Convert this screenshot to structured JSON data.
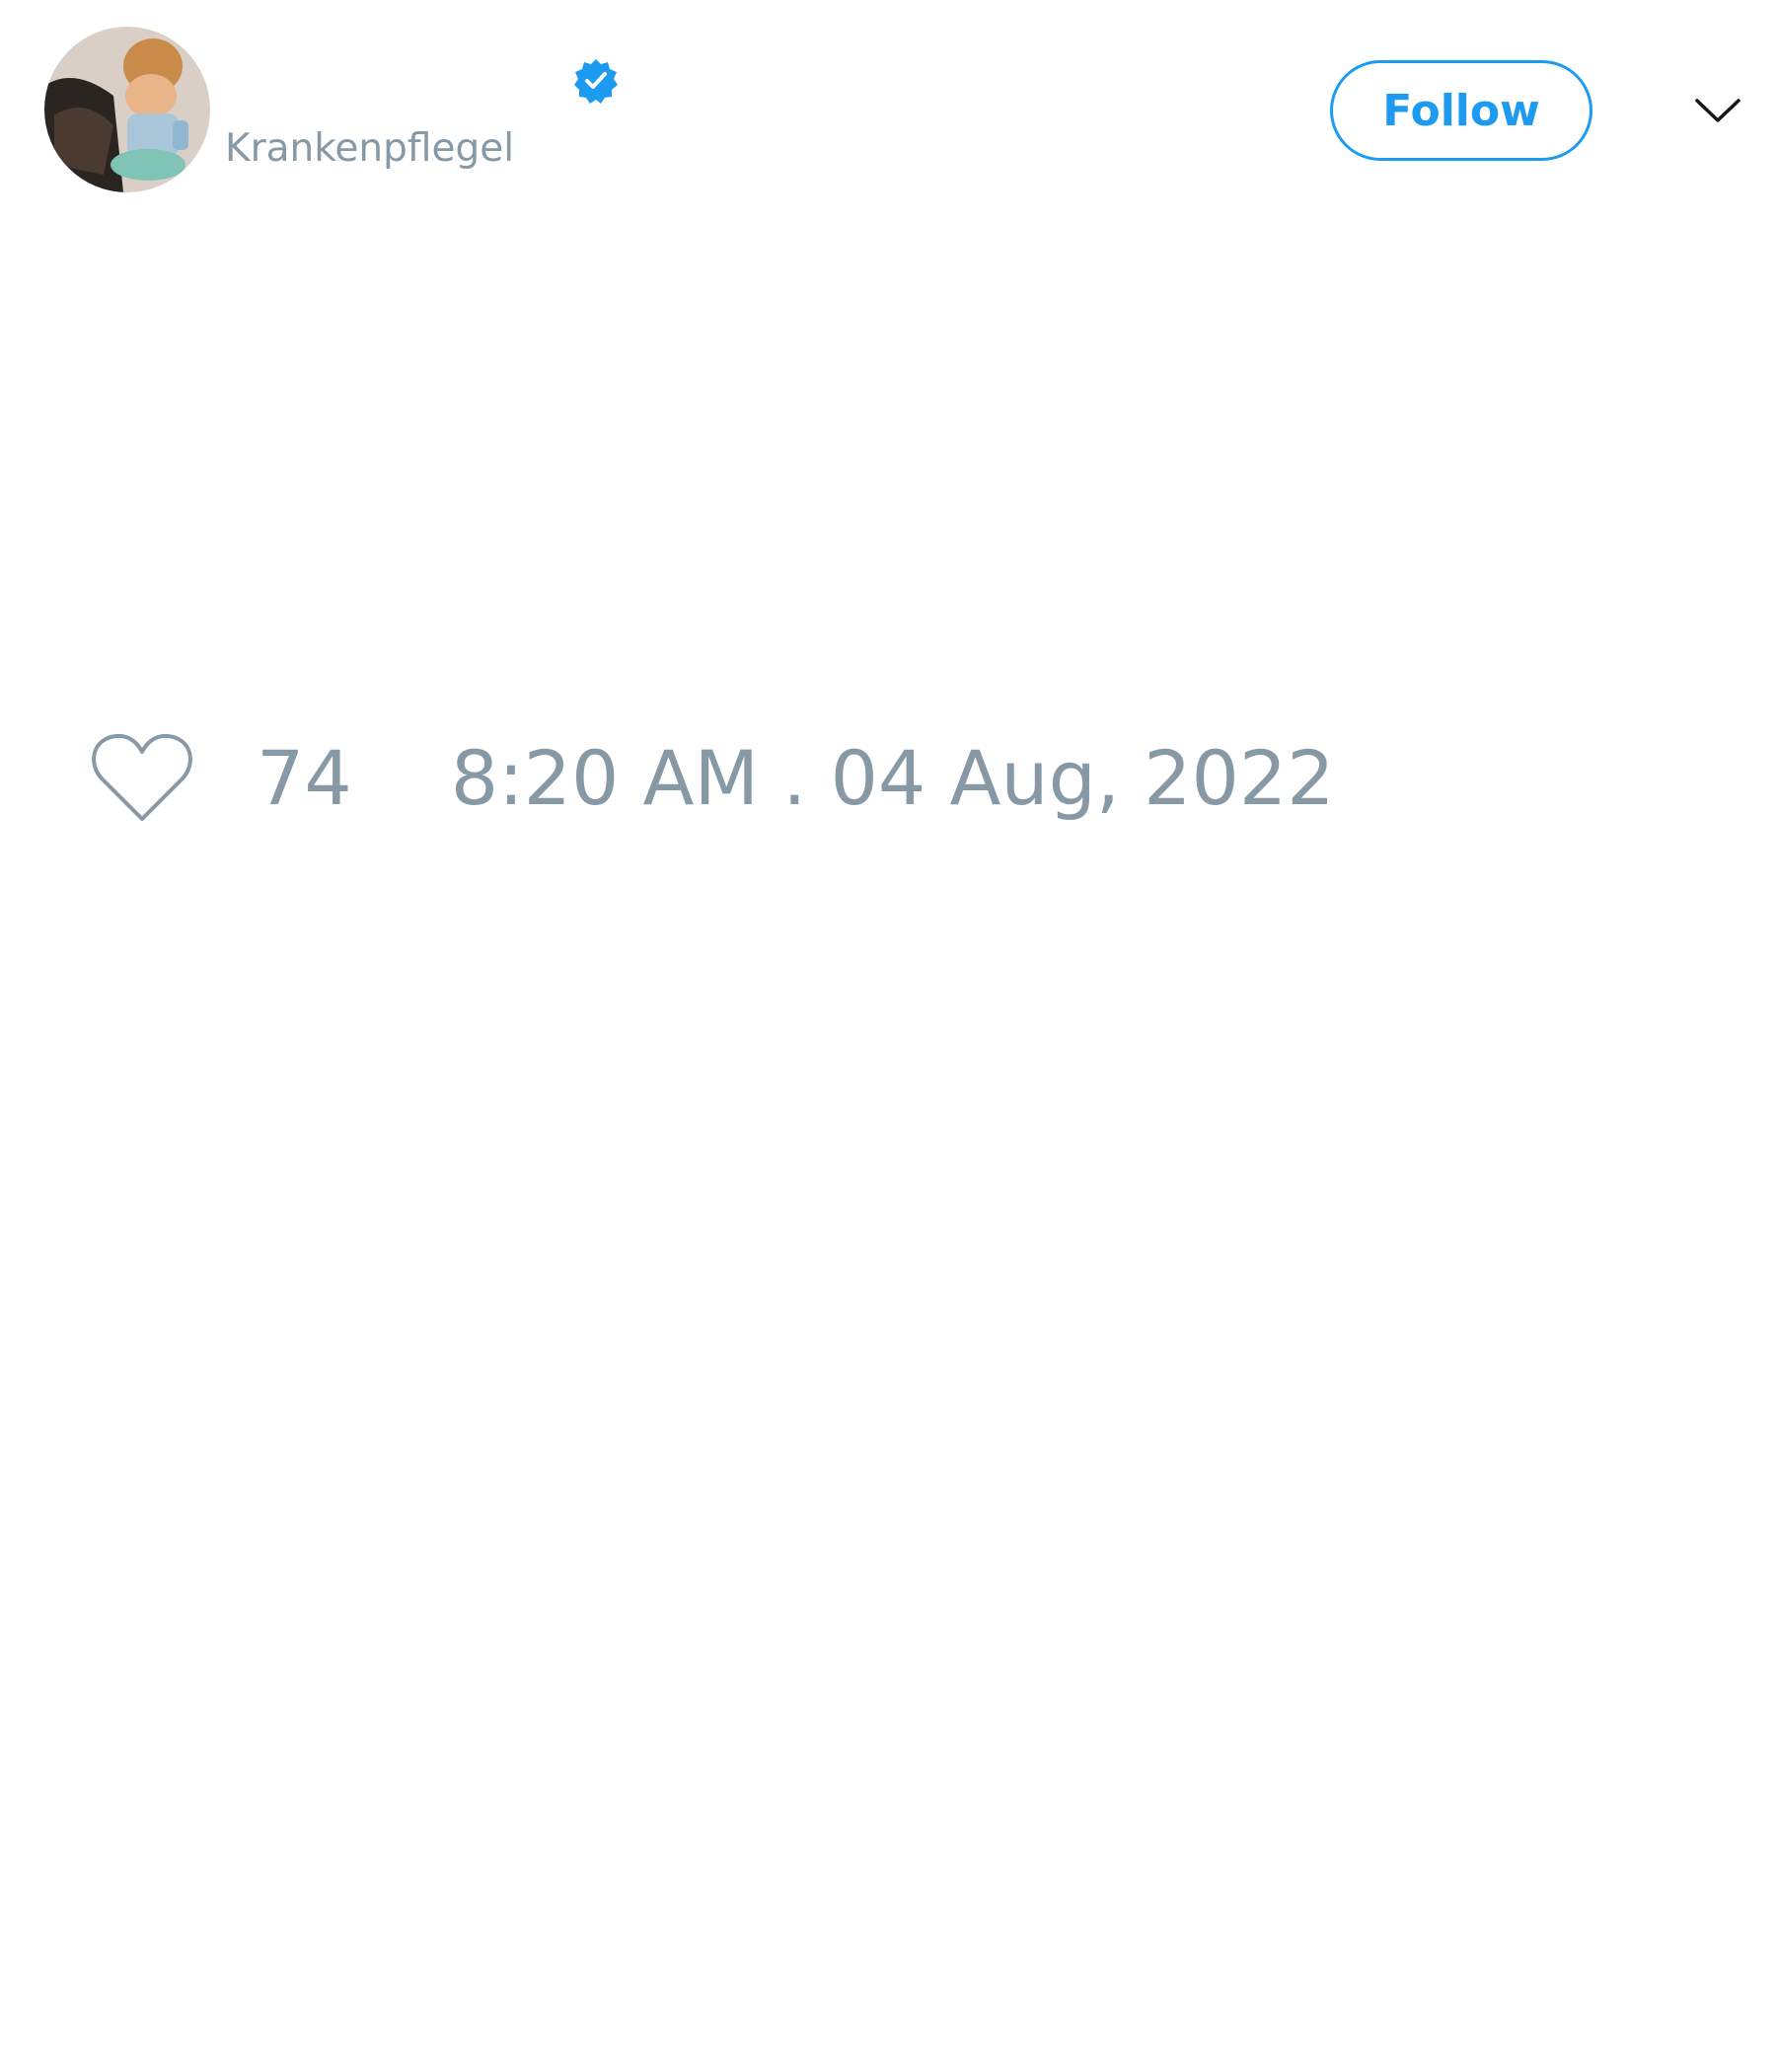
{
  "author": {
    "display_name": "",
    "handle": "Krankenpflegel",
    "verified": true,
    "avatar_icon": "profile-photo-avatar"
  },
  "actions": {
    "follow_label": "Follow",
    "more_icon": "chevron-down-icon"
  },
  "engagement": {
    "like_icon": "heart-outline-icon",
    "like_count": "74",
    "timestamp": "8:20 AM . 04 Aug, 2022"
  },
  "colors": {
    "accent": "#1d9bf0",
    "muted_text": "#8899a6",
    "background": "#ffffff"
  }
}
